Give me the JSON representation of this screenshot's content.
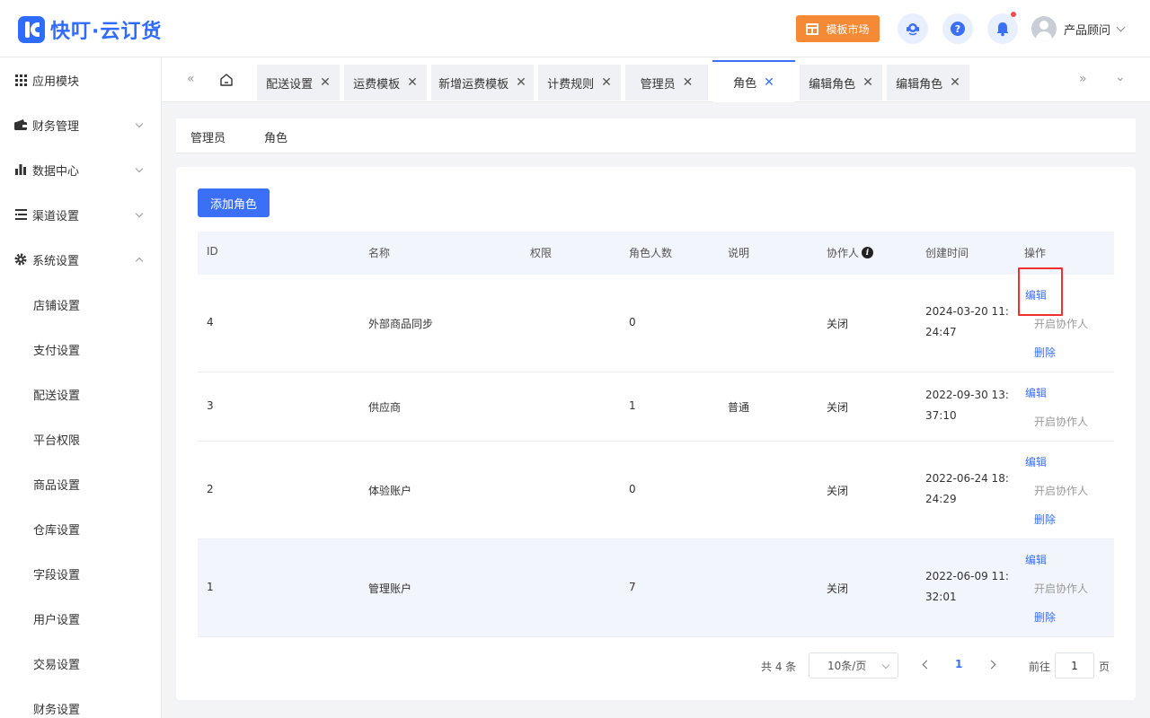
{
  "app": {
    "brand": "快叮·云订货"
  },
  "header": {
    "market_label": "模板市场",
    "user_name": "产品顾问",
    "colors": {
      "brand": "#2f6bff",
      "market": "#f58a36",
      "notify_dot": "#f5494f"
    }
  },
  "sidebar": {
    "items": [
      {
        "label": "应用模块",
        "icon": "grid-icon"
      },
      {
        "label": "财务管理",
        "icon": "wallet-icon"
      },
      {
        "label": "数据中心",
        "icon": "bar-chart-icon"
      },
      {
        "label": "渠道设置",
        "icon": "list-icon"
      },
      {
        "label": "系统设置",
        "icon": "gear-icon"
      }
    ],
    "subitems": [
      "店铺设置",
      "支付设置",
      "配送设置",
      "平台权限",
      "商品设置",
      "仓库设置",
      "字段设置",
      "用户设置",
      "交易设置",
      "财务设置"
    ]
  },
  "tabs": [
    {
      "label": "配送设置"
    },
    {
      "label": "运费模板"
    },
    {
      "label": "新增运费模板"
    },
    {
      "label": "计费规则"
    },
    {
      "label": "管理员"
    },
    {
      "label": "角色",
      "active": true
    },
    {
      "label": "编辑角色"
    },
    {
      "label": "编辑角色"
    }
  ],
  "subtabs": [
    "管理员",
    "角色"
  ],
  "add_button_label": "添加角色",
  "table": {
    "headers": {
      "id": "ID",
      "name": "名称",
      "perm": "权限",
      "count": "角色人数",
      "desc": "说明",
      "collab": "协作人",
      "created": "创建时间",
      "ops": "操作"
    },
    "rows": [
      {
        "id": "4",
        "name": "外部商品同步",
        "perm": "",
        "count": "0",
        "desc": "",
        "collab": "关闭",
        "created": "2024-03-20 11:24:47"
      },
      {
        "id": "3",
        "name": "供应商",
        "perm": "",
        "count": "1",
        "desc": "普通",
        "collab": "关闭",
        "created": "2022-09-30 13:37:10"
      },
      {
        "id": "2",
        "name": "体验账户",
        "perm": "",
        "count": "0",
        "desc": "",
        "collab": "关闭",
        "created": "2022-06-24 18:24:29"
      },
      {
        "id": "1",
        "name": "管理账户",
        "perm": "",
        "count": "7",
        "desc": "",
        "collab": "关闭",
        "created": "2022-06-09 11:32:01"
      }
    ],
    "ops": {
      "edit": "编辑",
      "collab": "开启协作人",
      "delete": "删除"
    }
  },
  "pagination": {
    "total_text": "共 4 条",
    "page_size": "10条/页",
    "current_page": "1",
    "goto_label": "前往",
    "goto_value": "1",
    "page_suffix": "页"
  },
  "accent": "#3b6ff5",
  "highlight_color": "#f03030"
}
